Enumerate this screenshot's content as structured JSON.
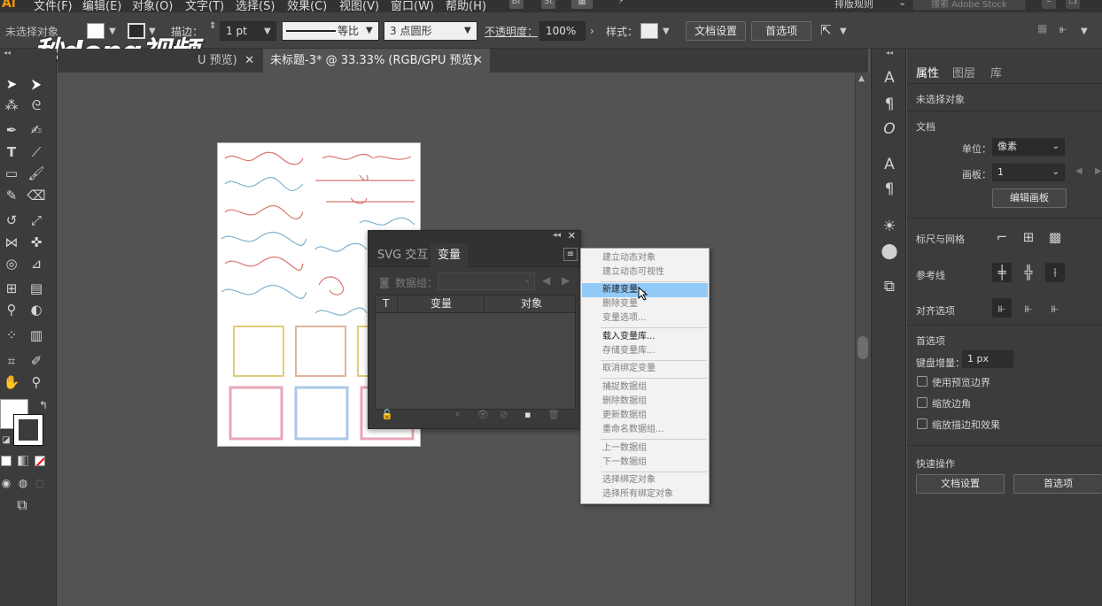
{
  "app": {
    "logo": "Ai",
    "watermark": "秒懂视频"
  },
  "menubar": {
    "items": [
      "文件(F)",
      "编辑(E)",
      "对象(O)",
      "文字(T)",
      "选择(S)",
      "效果(C)",
      "视图(V)",
      "窗口(W)",
      "帮助(H)"
    ],
    "bridge_label": "Br",
    "stock_label": "St",
    "workspace_label": "排版规则",
    "search_placeholder": "搜索 Adobe Stock"
  },
  "control_bar": {
    "selection_status": "未选择对象",
    "stroke_label": "描边：",
    "stroke_weight": "1 pt",
    "stroke_profile": "等比",
    "brush": "3 点圆形",
    "opacity_label": "不透明度：",
    "opacity_value": "100%",
    "style_label": "样式：",
    "doc_setup_button": "文档设置",
    "preferences_button": "首选项"
  },
  "tabs": [
    {
      "label": "U 预览)",
      "active": false
    },
    {
      "label": "未标题-3* @ 33.33% (RGB/GPU 预览)",
      "active": true
    }
  ],
  "variables_panel": {
    "tabs": [
      "SVG 交互",
      "变量"
    ],
    "active_tab": "变量",
    "dataset_label": "数据组：",
    "columns": [
      "T",
      "变量",
      "对象"
    ]
  },
  "context_menu": {
    "items": [
      {
        "label": "建立动态对象",
        "enabled": false,
        "highlighted": false
      },
      {
        "label": "建立动态可视性",
        "enabled": false,
        "highlighted": false
      },
      {
        "sep": true
      },
      {
        "label": "新建变量...",
        "enabled": true,
        "highlighted": true
      },
      {
        "label": "删除变量",
        "enabled": false,
        "highlighted": false
      },
      {
        "label": "变量选项...",
        "enabled": false,
        "highlighted": false
      },
      {
        "sep": true
      },
      {
        "label": "载入变量库...",
        "enabled": true,
        "highlighted": false
      },
      {
        "label": "存储变量库...",
        "enabled": false,
        "highlighted": false
      },
      {
        "sep": true
      },
      {
        "label": "取消绑定变量",
        "enabled": false,
        "highlighted": false
      },
      {
        "sep": true
      },
      {
        "label": "捕捉数据组",
        "enabled": false,
        "highlighted": false
      },
      {
        "label": "删除数据组",
        "enabled": false,
        "highlighted": false
      },
      {
        "label": "更新数据组",
        "enabled": false,
        "highlighted": false
      },
      {
        "label": "重命名数据组...",
        "enabled": false,
        "highlighted": false
      },
      {
        "sep": true
      },
      {
        "label": "上一数据组",
        "enabled": false,
        "highlighted": false
      },
      {
        "label": "下一数据组",
        "enabled": false,
        "highlighted": false
      },
      {
        "sep": true
      },
      {
        "label": "选择绑定对象",
        "enabled": false,
        "highlighted": false
      },
      {
        "label": "选择所有绑定对象",
        "enabled": false,
        "highlighted": false
      }
    ]
  },
  "properties_panel": {
    "tabs": [
      "属性",
      "图层",
      "库"
    ],
    "active_tab": "属性",
    "no_selection": "未选择对象",
    "document_section": "文档",
    "units_label": "单位：",
    "units_value": "像素",
    "artboard_label": "画板：",
    "artboard_value": "1",
    "edit_artboards_button": "编辑画板",
    "rulers_grids_section": "标尺与网格",
    "guides_section": "参考线",
    "align_options_section": "对齐选项",
    "preferences_section": "首选项",
    "keyboard_increment_label": "键盘增量：",
    "keyboard_increment_value": "1 px",
    "use_preview_bounds": "使用预览边界",
    "scale_corners": "缩放边角",
    "scale_strokes_effects": "缩放描边和效果",
    "quick_actions_section": "快速操作",
    "doc_setup_button": "文档设置",
    "preferences_button": "首选项"
  },
  "colors": {
    "accent_highlight": "#91c9f7",
    "panel_bg": "#3c3c3c",
    "canvas_bg": "#535353",
    "ornament_red": "#d9786e",
    "ornament_blue": "#7fb3cc",
    "ornament_pink": "#e8a6b6",
    "ornament_gold": "#e0cc7a"
  },
  "icons": {
    "toolbar": [
      "selection-tool-icon",
      "direct-selection-tool-icon",
      "magic-wand-icon",
      "lasso-icon",
      "pen-icon",
      "curvature-icon",
      "type-icon",
      "line-icon",
      "rectangle-icon",
      "paintbrush-icon",
      "shaper-icon",
      "eraser-icon",
      "rotate-icon",
      "scale-icon",
      "width-icon",
      "puppet-warp-icon",
      "shape-builder-icon",
      "perspective-icon",
      "mesh-icon",
      "gradient-icon",
      "eyedropper-icon",
      "blend-icon",
      "symbol-sprayer-icon",
      "graph-icon",
      "artboard-icon",
      "slice-icon",
      "hand-icon",
      "zoom-icon"
    ]
  }
}
